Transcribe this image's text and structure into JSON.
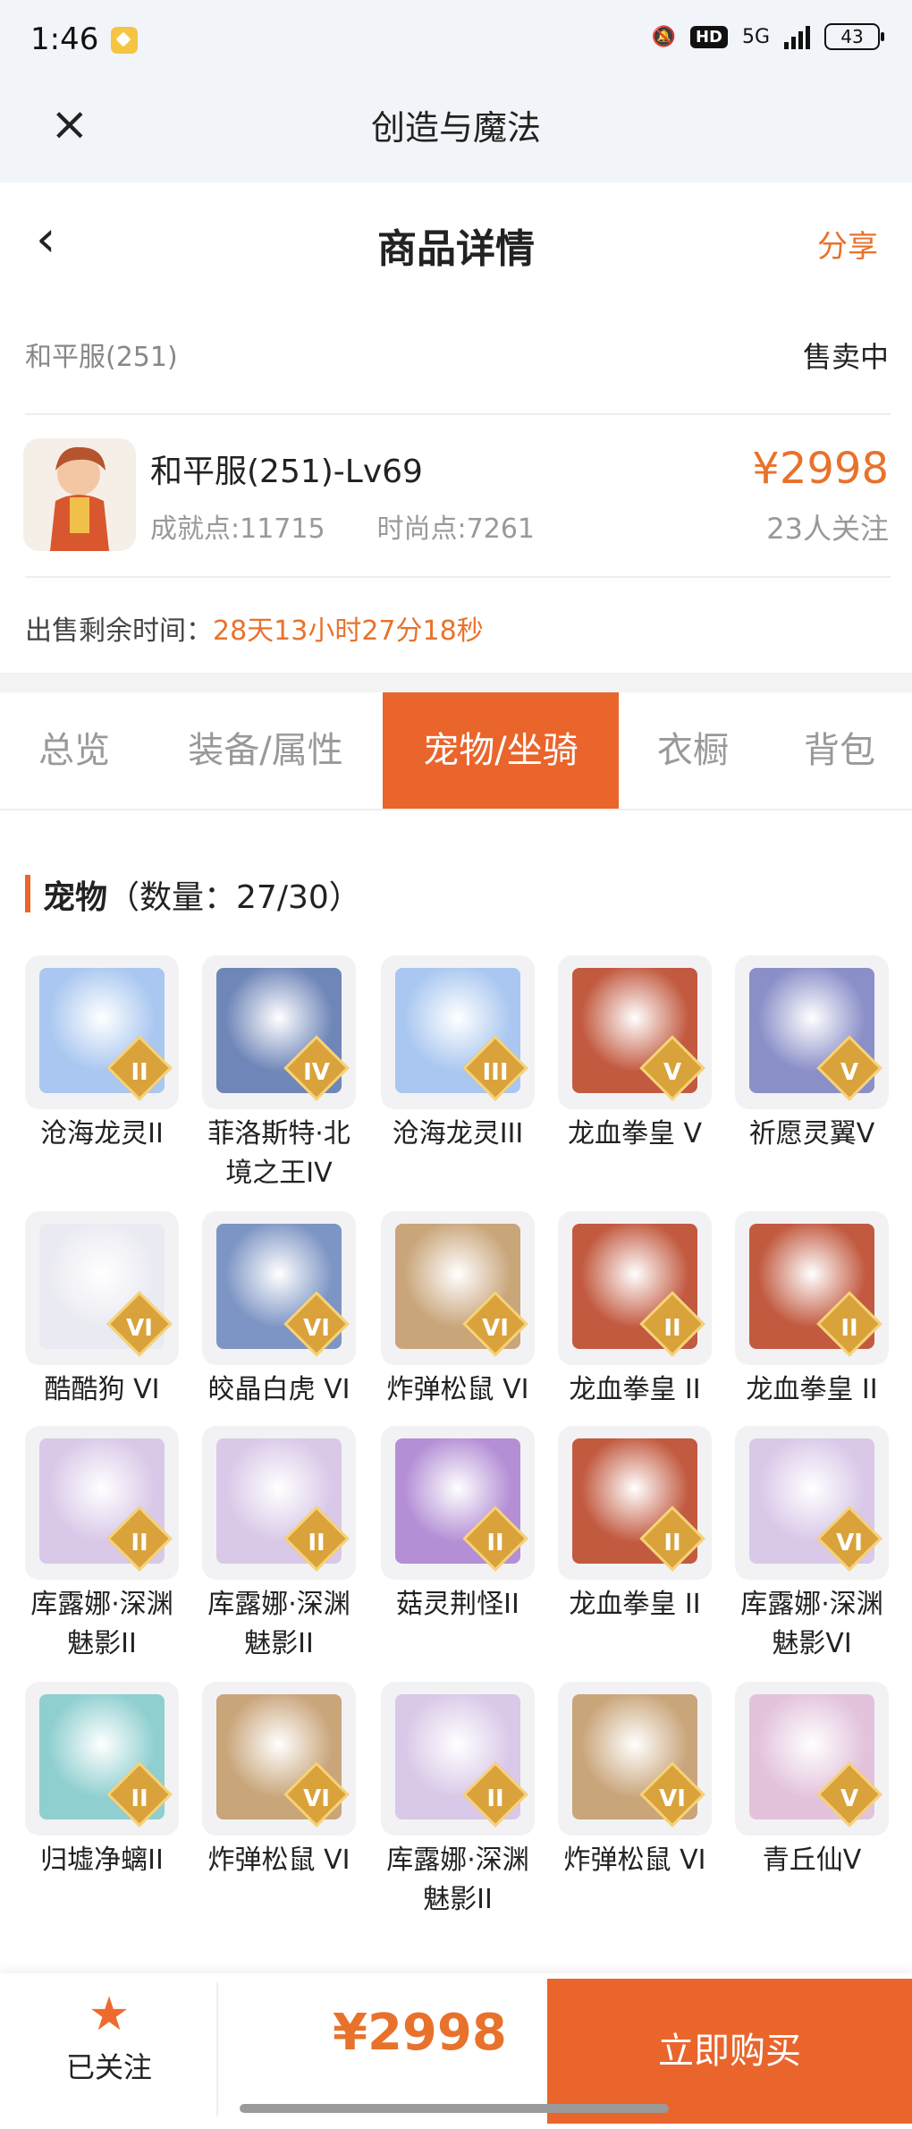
{
  "status_bar": {
    "time": "1:46",
    "hd": "HD",
    "network": "5G",
    "battery": "43"
  },
  "app_bar": {
    "title": "创造与魔法"
  },
  "nav": {
    "title": "商品详情",
    "share": "分享"
  },
  "info": {
    "server": "和平服(251)",
    "status": "售卖中",
    "product_name": "和平服(251)-Lv69",
    "achievement": "成就点:11715",
    "fashion": "时尚点:7261",
    "price": "¥2998",
    "follows": "23人关注",
    "remain_label": "出售剩余时间：",
    "remain_value": "28天13小时27分18秒"
  },
  "tabs": [
    {
      "label": "总览",
      "active": false
    },
    {
      "label": "装备/属性",
      "active": false
    },
    {
      "label": "宠物/坐骑",
      "active": true
    },
    {
      "label": "衣橱",
      "active": false
    },
    {
      "label": "背包",
      "active": false
    }
  ],
  "section": {
    "title": "宠物",
    "count": "（数量：27/30）"
  },
  "pets": [
    {
      "name": "沧海龙灵II",
      "badge": "II",
      "color": "#a9c7f0"
    },
    {
      "name": "菲洛斯特·北境之王IV",
      "badge": "IV",
      "color": "#6f86b8"
    },
    {
      "name": "沧海龙灵III",
      "badge": "III",
      "color": "#a9c7f0"
    },
    {
      "name": "龙血拳皇 V",
      "badge": "V",
      "color": "#c25a40"
    },
    {
      "name": "祈愿灵翼V",
      "badge": "V",
      "color": "#8a8fc8"
    },
    {
      "name": "酷酷狗 VI",
      "badge": "VI",
      "color": "#eaeaf2"
    },
    {
      "name": "皎晶白虎 VI",
      "badge": "VI",
      "color": "#7d95c4"
    },
    {
      "name": "炸弹松鼠 VI",
      "badge": "VI",
      "color": "#c9a57a"
    },
    {
      "name": "龙血拳皇 II",
      "badge": "II",
      "color": "#c25a40"
    },
    {
      "name": "龙血拳皇 II",
      "badge": "II",
      "color": "#c25a40"
    },
    {
      "name": "库露娜·深渊魅影II",
      "badge": "II",
      "color": "#d9c8e8"
    },
    {
      "name": "库露娜·深渊魅影II",
      "badge": "II",
      "color": "#d9c8e8"
    },
    {
      "name": "菇灵荆怪II",
      "badge": "II",
      "color": "#b48fd6"
    },
    {
      "name": "龙血拳皇 II",
      "badge": "II",
      "color": "#c25a40"
    },
    {
      "name": "库露娜·深渊魅影VI",
      "badge": "VI",
      "color": "#d9c8e8"
    },
    {
      "name": "归墟净螭II",
      "badge": "II",
      "color": "#8fcfd0"
    },
    {
      "name": "炸弹松鼠 VI",
      "badge": "VI",
      "color": "#c9a57a"
    },
    {
      "name": "库露娜·深渊魅影II",
      "badge": "II",
      "color": "#d9c8e8"
    },
    {
      "name": "炸弹松鼠 VI",
      "badge": "VI",
      "color": "#c9a57a"
    },
    {
      "name": "青丘仙V",
      "badge": "V",
      "color": "#e3c3dc"
    }
  ],
  "bottom": {
    "followed": "已关注",
    "price": "¥2998",
    "buy": "立即购买"
  },
  "colors": {
    "accent": "#e9652c",
    "price": "#e8722c"
  }
}
